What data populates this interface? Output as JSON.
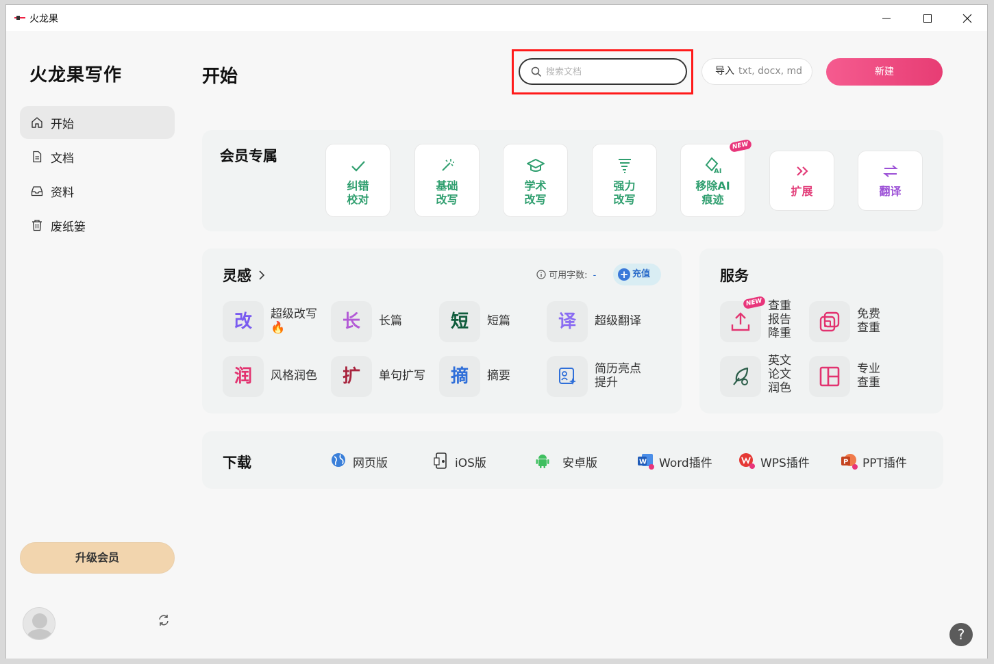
{
  "window": {
    "title": "火龙果"
  },
  "sidebar": {
    "brand": "火龙果写作",
    "items": [
      {
        "label": "开始",
        "icon": "home-icon"
      },
      {
        "label": "文档",
        "icon": "document-icon"
      },
      {
        "label": "资料",
        "icon": "inbox-icon"
      },
      {
        "label": "废纸篓",
        "icon": "trash-icon"
      }
    ],
    "active": "开始",
    "upgrade_label": "升级会员"
  },
  "header": {
    "title": "开始",
    "search_placeholder": "搜索文档",
    "import_label": "导入",
    "import_formats": "txt, docx, md",
    "new_label": "新建"
  },
  "member": {
    "title": "会员专属",
    "badge": "NEW",
    "tiles": [
      {
        "line1": "纠错",
        "line2": "校对",
        "icon": "check-icon",
        "color": "#2e9e6e"
      },
      {
        "line1": "基础",
        "line2": "改写",
        "icon": "magic-wand-icon",
        "color": "#2e9e6e"
      },
      {
        "line1": "学术",
        "line2": "改写",
        "icon": "graduation-cap-icon",
        "color": "#2e9e6e"
      },
      {
        "line1": "强力",
        "line2": "改写",
        "icon": "tornado-icon",
        "color": "#2e9e6e"
      },
      {
        "line1": "移除AI",
        "line2": "痕迹",
        "icon": "eraser-ai-icon",
        "color": "#2e9e6e"
      },
      {
        "line1": "扩展",
        "line2": "",
        "icon": "double-chevron-icon",
        "color": "#e23c78"
      },
      {
        "line1": "翻译",
        "line2": "",
        "icon": "swap-arrows-icon",
        "color": "#9b4fd6"
      }
    ]
  },
  "inspiration": {
    "title": "灵感",
    "quota_label": "可用字数:",
    "quota_value": "-",
    "recharge_label": "充值",
    "items": [
      {
        "char": "改",
        "label": "超级改写",
        "extra": "🔥",
        "color": "#7a5cf0"
      },
      {
        "char": "长",
        "label": "长篇",
        "color": "#b35ad6"
      },
      {
        "char": "短",
        "label": "短篇",
        "color": "#0f5c3c"
      },
      {
        "char": "译",
        "label": "超级翻译",
        "color": "#8a6cf2"
      },
      {
        "char": "润",
        "label": "风格润色",
        "color": "#e2326f"
      },
      {
        "char": "扩",
        "label": "单句扩写",
        "color": "#a8243e"
      },
      {
        "char": "摘",
        "label": "摘要",
        "color": "#2f6fd9"
      },
      {
        "char": "",
        "label": "简历亮点提升",
        "line1": "简历亮点",
        "line2": "提升",
        "color": "#2f6fd9"
      }
    ]
  },
  "services": {
    "title": "服务",
    "badge": "NEW",
    "items": [
      {
        "lines": [
          "查重",
          "报告",
          "降重"
        ],
        "icon": "upload-icon",
        "color": "#e2326f"
      },
      {
        "lines": [
          "免费",
          "查重"
        ],
        "icon": "copy-squares-icon",
        "color": "#e2326f"
      },
      {
        "lines": [
          "英文",
          "论文",
          "润色"
        ],
        "icon": "quill-icon",
        "color": "#2c5e4a"
      },
      {
        "lines": [
          "专业",
          "查重"
        ],
        "icon": "layout-panel-icon",
        "color": "#e2326f"
      }
    ]
  },
  "download": {
    "title": "下载",
    "items": [
      {
        "label": "网页版",
        "icon": "globe-icon"
      },
      {
        "label": "iOS版",
        "icon": "ios-phone-icon"
      },
      {
        "label": "安卓版",
        "icon": "android-icon"
      },
      {
        "label": "Word插件",
        "icon": "word-icon"
      },
      {
        "label": "WPS插件",
        "icon": "wps-icon"
      },
      {
        "label": "PPT插件",
        "icon": "ppt-icon"
      }
    ]
  },
  "help": {
    "label": "?"
  }
}
